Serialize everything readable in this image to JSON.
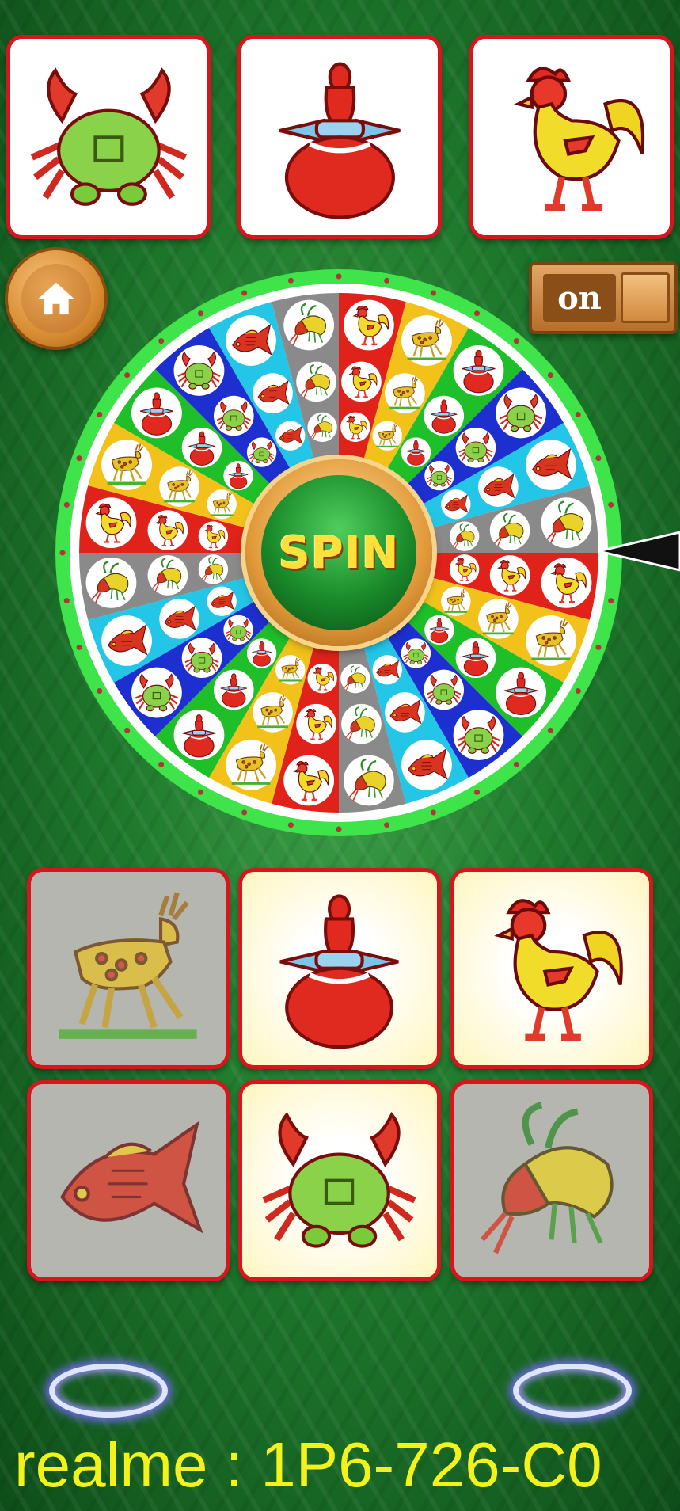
{
  "result_row": [
    "crab-icon",
    "gourd-icon",
    "rooster-icon"
  ],
  "home_button": {
    "icon": "home-icon"
  },
  "sound_toggle": {
    "label": "on"
  },
  "spin_button": {
    "label": "SPIN"
  },
  "betting_board": [
    {
      "icon": "deer-icon",
      "state": "dim"
    },
    {
      "icon": "gourd-icon",
      "state": "lit"
    },
    {
      "icon": "rooster-icon",
      "state": "lit"
    },
    {
      "icon": "fish-icon",
      "state": "dim"
    },
    {
      "icon": "crab-icon",
      "state": "lit"
    },
    {
      "icon": "shrimp-icon",
      "state": "dim"
    }
  ],
  "footer": {
    "device_text": "realme : 1P6-726-C0"
  },
  "colors": {
    "card_border": "#d8141c",
    "wheel_rim": "#3fe34a",
    "footer_text": "#f3f21a",
    "spin_text": "#ffdf3a"
  }
}
